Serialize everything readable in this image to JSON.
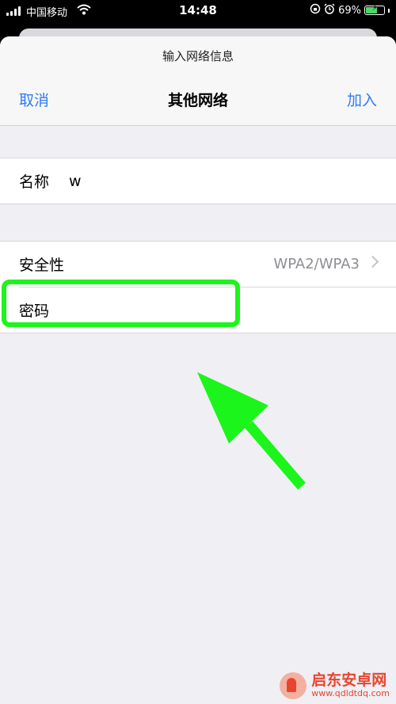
{
  "status_bar": {
    "carrier": "中国移动",
    "time": "14:48",
    "battery_percent": "69%",
    "battery_level": 0.69,
    "icons": [
      "signal-icon",
      "wifi-icon",
      "rotation-lock-icon",
      "alarm-icon",
      "battery-charging-icon"
    ]
  },
  "header": {
    "prompt": "输入网络信息",
    "cancel_label": "取消",
    "title": "其他网络",
    "join_label": "加入"
  },
  "form": {
    "name_label": "名称",
    "name_value": "w",
    "security_label": "安全性",
    "security_value": "WPA2/WPA3",
    "password_label": "密码"
  },
  "annotation": {
    "highlight_color": "#1bf51b",
    "arrow_color": "#1bf51b"
  },
  "watermark": {
    "name": "启东安卓网",
    "url": "www.qdldtdq.com"
  },
  "colors": {
    "accent": "#2f7cf6",
    "background": "#efeff4"
  }
}
